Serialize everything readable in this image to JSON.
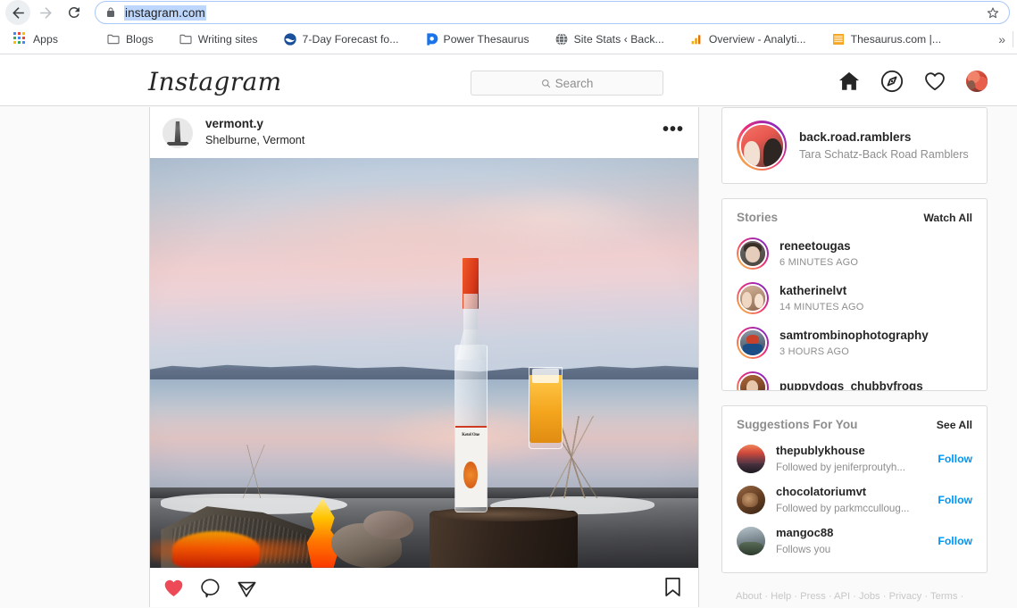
{
  "browser": {
    "back_icon": "arrow-left",
    "forward_icon": "arrow-right",
    "reload_icon": "reload",
    "lock_icon": "lock",
    "url": "instagram.com",
    "star_icon": "star",
    "overflow_label": "»",
    "bookmarks": [
      {
        "label": "Apps",
        "icon": "apps-grid"
      },
      {
        "label": "Blogs",
        "icon": "folder"
      },
      {
        "label": "Writing sites",
        "icon": "folder"
      },
      {
        "label": "7-Day Forecast fo...",
        "icon": "noaa"
      },
      {
        "label": "Power Thesaurus",
        "icon": "power-thesaurus"
      },
      {
        "label": "Site Stats ‹ Back...",
        "icon": "globe"
      },
      {
        "label": "Overview - Analyti...",
        "icon": "analytics-bars"
      },
      {
        "label": "Thesaurus.com |...",
        "icon": "thesaurus"
      }
    ]
  },
  "ig_nav": {
    "logo": "Instagram",
    "search_placeholder": "Search",
    "search_icon": "search-icon",
    "icons": [
      {
        "name": "home-icon"
      },
      {
        "name": "explore-icon"
      },
      {
        "name": "activity-heart-icon"
      },
      {
        "name": "profile-avatar"
      }
    ]
  },
  "post": {
    "username": "vermont.y",
    "location": "Shelburne, Vermont",
    "more_icon": "•••",
    "photo_alt": "Campfire beside a lake at sunset with a Ketel One Oranje bottle and an orange cocktail on a tree stump",
    "photo": {
      "bottle_label": "Ketel One",
      "bottle_sub": "ORANJE"
    },
    "actions": {
      "like_icon": "heart-filled-icon",
      "like_color": "#ed4956",
      "comment_icon": "comment-icon",
      "share_icon": "share-paper-plane-icon",
      "save_icon": "bookmark-icon"
    }
  },
  "sidebar": {
    "profile": {
      "username": "back.road.ramblers",
      "fullname": "Tara Schatz-Back Road Ramblers"
    },
    "stories": {
      "title": "Stories",
      "action": "Watch All",
      "items": [
        {
          "username": "reneetougas",
          "time": "6 MINUTES AGO"
        },
        {
          "username": "katherinelvt",
          "time": "14 MINUTES AGO"
        },
        {
          "username": "samtrombinophotography",
          "time": "3 HOURS AGO"
        },
        {
          "username": "puppydogs_chubbyfrogs",
          "time": ""
        }
      ]
    },
    "suggestions": {
      "title": "Suggestions For You",
      "action": "See All",
      "items": [
        {
          "username": "thepublykhouse",
          "sub": "Followed by jeniferproutyh...",
          "button": "Follow"
        },
        {
          "username": "chocolatoriumvt",
          "sub": "Followed by parkmcculloug...",
          "button": "Follow"
        },
        {
          "username": "mangoc88",
          "sub": "Follows you",
          "button": "Follow"
        }
      ]
    },
    "footer": "About · Help · Press · API · Jobs · Privacy · Terms ·"
  },
  "colors": {
    "accent_blue": "#0095f6",
    "like_red": "#ed4956",
    "page_bg": "#fafafa",
    "border": "#dbdbdb",
    "text_primary": "#262626",
    "text_secondary": "#8e8e8e"
  }
}
